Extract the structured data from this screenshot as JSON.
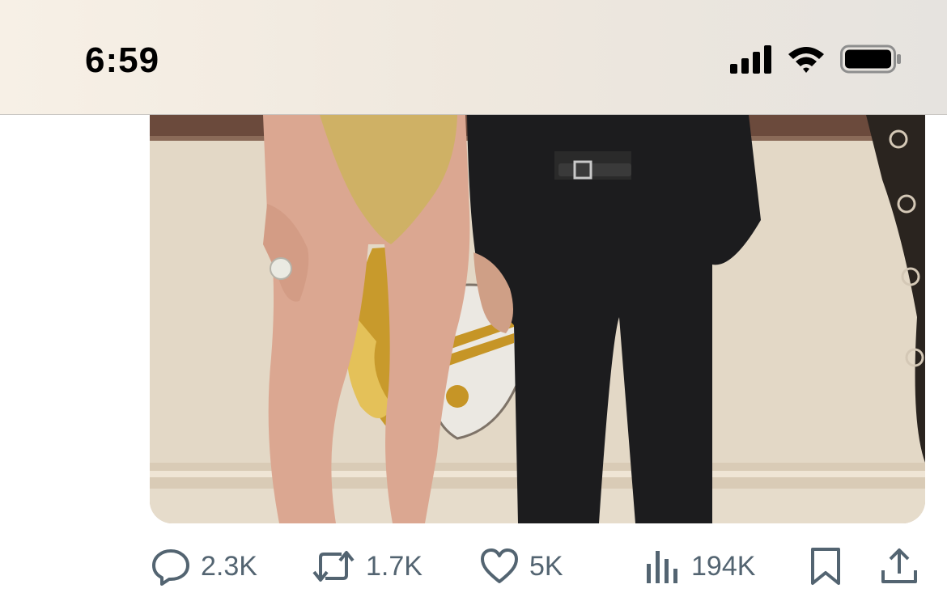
{
  "status_bar": {
    "time": "6:59",
    "icons": [
      "cellular-signal-icon",
      "wifi-icon",
      "battery-icon"
    ]
  },
  "post": {
    "media": {
      "type": "photo"
    },
    "actions": {
      "reply": {
        "icon": "reply-icon",
        "count": "2.3K"
      },
      "repost": {
        "icon": "repost-icon",
        "count": "1.7K"
      },
      "like": {
        "icon": "heart-icon",
        "count": "5K"
      },
      "views": {
        "icon": "views-icon",
        "count": "194K"
      },
      "bookmark": {
        "icon": "bookmark-icon"
      },
      "share": {
        "icon": "share-icon"
      }
    }
  },
  "colors": {
    "action_gray": "#536471",
    "status_bg": "#efe8de"
  }
}
